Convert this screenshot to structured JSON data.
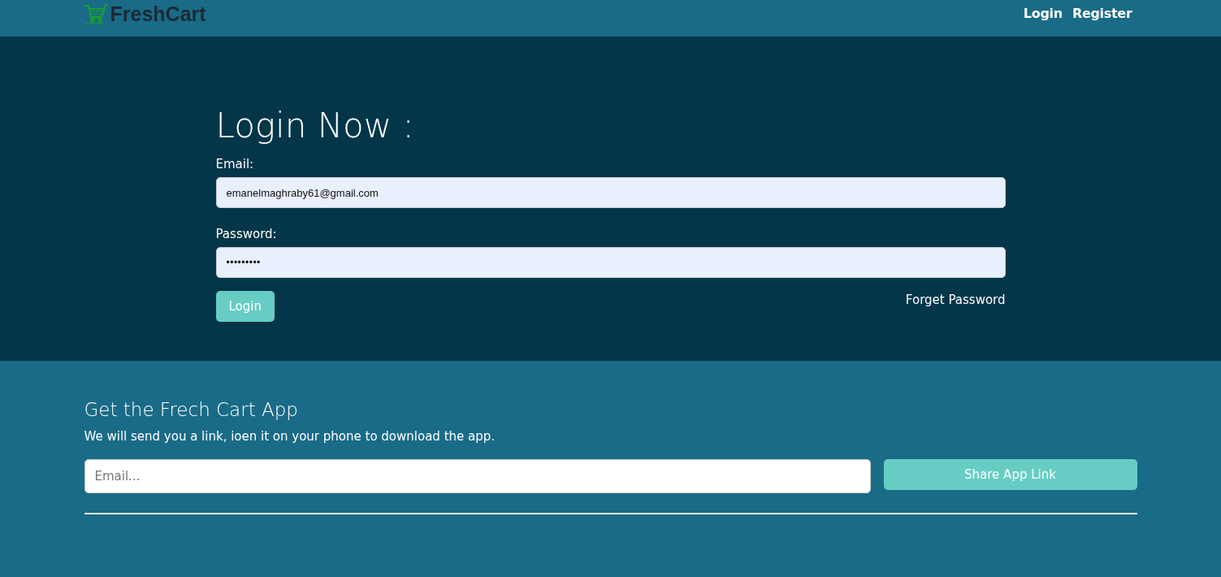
{
  "navbar": {
    "brand": "FreshCart",
    "links": [
      {
        "label": "Login"
      },
      {
        "label": "Register"
      }
    ]
  },
  "login_form": {
    "title": "Login Now :",
    "fields": [
      {
        "label": "Email:",
        "kind": "email",
        "value": "emanelmaghraby61@gmail.com",
        "autofilled": true
      },
      {
        "label": "Password:",
        "kind": "password",
        "value": "•••••••••",
        "autofilled": true
      }
    ],
    "submit": "Login",
    "forgot_link": "Forget Password"
  },
  "app_section": {
    "title": "Get the Frech Cart App",
    "text": "We will send you a link, ioen it on your phone to download the app.",
    "email_field": {
      "placeholder": "Email..."
    },
    "button": "Share App Link"
  }
}
